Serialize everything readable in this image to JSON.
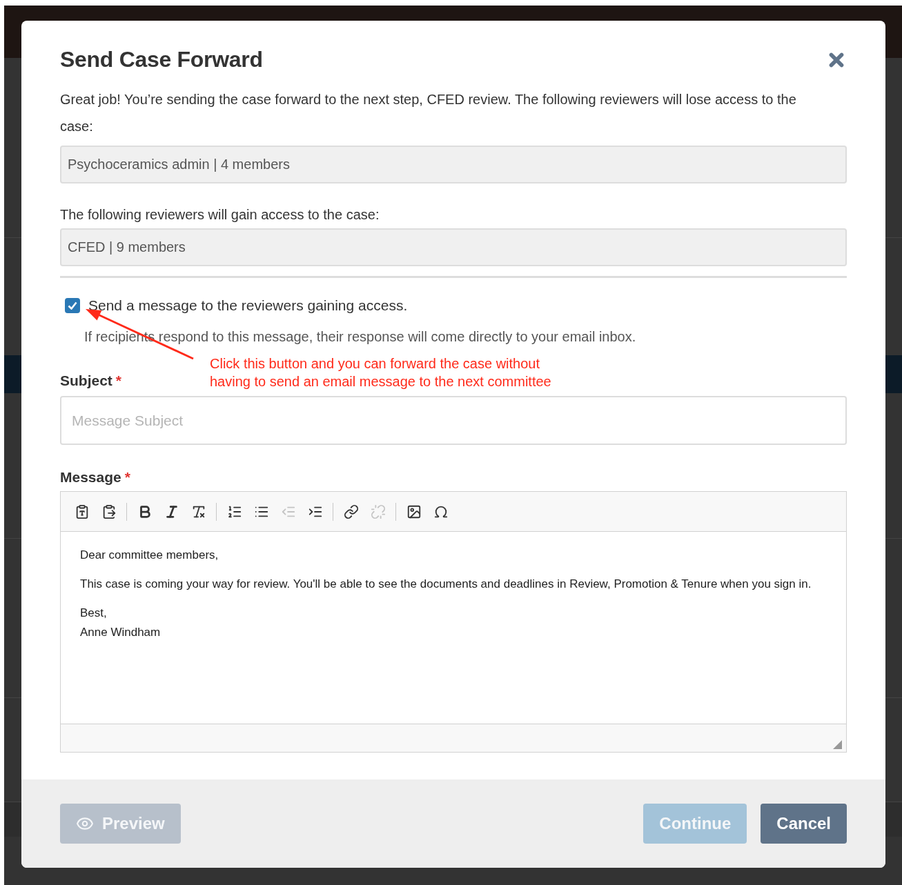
{
  "modal": {
    "title": "Send Case Forward",
    "intro": "Great job! You’re sending the case forward to the next step, CFED review. The following reviewers will lose access to the case:",
    "losing_field": {
      "value": "Psychoceramics admin | 4 members"
    },
    "gain_label": "The following reviewers will gain access to the case:",
    "gaining_field": {
      "value": "CFED | 9 members"
    },
    "send_message": {
      "label": "Send a message to the reviewers gaining access.",
      "checked": true,
      "hint": "If recipients respond to this message, their response will come directly to your email inbox."
    },
    "annotation": {
      "lines": [
        "Click this button and you can forward the case without",
        "having to send an email message to the next committee"
      ]
    },
    "subject": {
      "label": "Subject",
      "required_mark": "*",
      "placeholder": "Message Subject"
    },
    "message": {
      "label": "Message",
      "required_mark": "*",
      "toolbar": [
        {
          "kind": "paste-text",
          "disabled": false
        },
        {
          "kind": "paste-word",
          "disabled": false
        },
        {
          "kind": "separator"
        },
        {
          "kind": "bold",
          "disabled": false
        },
        {
          "kind": "italic",
          "disabled": false
        },
        {
          "kind": "remove-format",
          "disabled": false
        },
        {
          "kind": "separator"
        },
        {
          "kind": "numbered-list",
          "disabled": false
        },
        {
          "kind": "bulleted-list",
          "disabled": false
        },
        {
          "kind": "outdent",
          "disabled": true
        },
        {
          "kind": "indent",
          "disabled": false
        },
        {
          "kind": "separator"
        },
        {
          "kind": "link",
          "disabled": false
        },
        {
          "kind": "unlink",
          "disabled": true
        },
        {
          "kind": "separator"
        },
        {
          "kind": "image",
          "disabled": false
        },
        {
          "kind": "special-character",
          "disabled": false
        }
      ],
      "body": [
        [
          "Dear committee members,"
        ],
        [
          "This case is coming your way for review. You'll be able to see the documents and deadlines in Review, Promotion & Tenure when you sign in."
        ],
        [
          "Best,",
          "Anne Windham"
        ]
      ]
    },
    "buttons": [
      {
        "label": "Preview",
        "kind": "secondary",
        "disabled": true
      },
      {
        "label": "Continue",
        "kind": "primary",
        "disabled": true
      },
      {
        "label": "Cancel",
        "kind": "neutral",
        "disabled": false
      }
    ]
  }
}
